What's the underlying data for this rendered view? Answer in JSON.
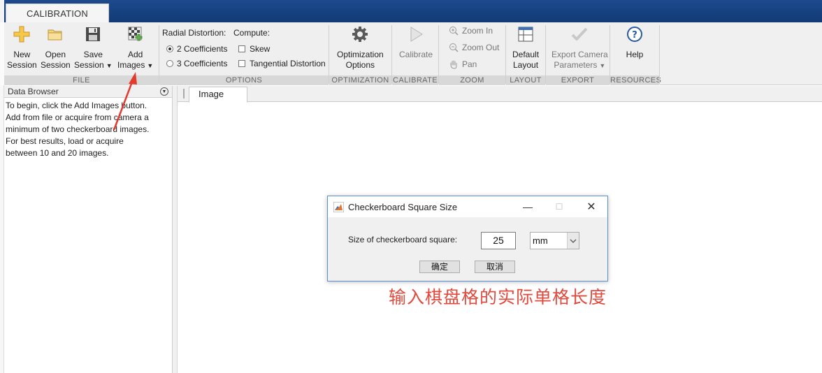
{
  "app": {
    "tab_label": "CALIBRATION"
  },
  "ribbon": {
    "file": {
      "group_label": "FILE",
      "new_session": [
        "New",
        "Session"
      ],
      "open_session": [
        "Open",
        "Session"
      ],
      "save_session": [
        "Save",
        "Session"
      ],
      "add_images": [
        "Add",
        "Images"
      ]
    },
    "options": {
      "group_label": "OPTIONS",
      "radial_label": "Radial Distortion:",
      "radial_choices": [
        "2 Coefficients",
        "3 Coefficients"
      ],
      "radial_selected": "2 Coefficients",
      "compute_label": "Compute:",
      "compute_choices": [
        "Skew",
        "Tangential Distortion"
      ]
    },
    "optimization": {
      "group_label": "OPTIMIZATION",
      "button": [
        "Optimization",
        "Options"
      ]
    },
    "calibrate": {
      "group_label": "CALIBRATE",
      "button": "Calibrate"
    },
    "zoom": {
      "group_label": "ZOOM",
      "zoom_in": "Zoom In",
      "zoom_out": "Zoom Out",
      "pan": "Pan"
    },
    "layout": {
      "group_label": "LAYOUT",
      "button": [
        "Default",
        "Layout"
      ]
    },
    "export": {
      "group_label": "EXPORT",
      "button": [
        "Export Camera",
        "Parameters"
      ]
    },
    "resources": {
      "group_label": "RESOURCES",
      "button": "Help"
    }
  },
  "data_browser": {
    "title": "Data Browser",
    "lines": [
      "To begin, click the Add Images button.",
      "Add from file or acquire from camera a",
      "minimum of two checkerboard images.",
      "For best results, load or acquire",
      "between 10 and 20 images."
    ]
  },
  "image_panel": {
    "tab": "Image"
  },
  "dialog": {
    "title": "Checkerboard Square Size",
    "size_label": "Size of checkerboard square:",
    "size_value": "25",
    "unit_selected": "mm",
    "ok_label": "确定",
    "cancel_label": "取消"
  },
  "annotation": {
    "text": "输入棋盘格的实际单格长度",
    "color": "#e2493d"
  },
  "colors": {
    "title_bar": "#1e4a8e",
    "ribbon": "#f0f0f0",
    "group_label_bg": "#d8d8d8",
    "dialog_border": "#5b8fd0"
  }
}
